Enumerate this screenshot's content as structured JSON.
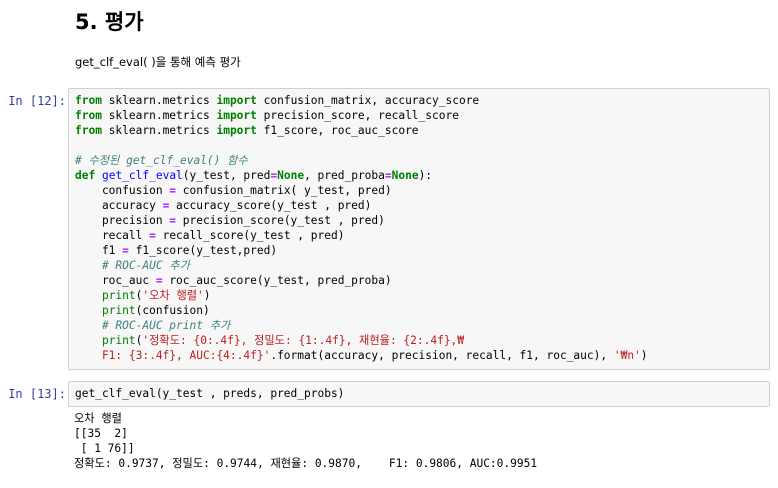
{
  "markdown": {
    "heading": "5. 평가",
    "text": "get_clf_eval( )을 통해 예측 평가"
  },
  "cell12": {
    "prompt": "In [12]:",
    "line1": {
      "a": "from",
      "b": " sklearn.metrics ",
      "c": "import",
      "d": " confusion_matrix, accuracy_score"
    },
    "line2": {
      "a": "from",
      "b": " sklearn.metrics ",
      "c": "import",
      "d": " precision_score, recall_score"
    },
    "line3": {
      "a": "from",
      "b": " sklearn.metrics ",
      "c": "import",
      "d": " f1_score, roc_auc_score"
    },
    "comment1": "# 수정된 get_clf_eval() 함수",
    "def": {
      "kw": "def",
      "name": "get_clf_eval",
      "args1": "(y_test, pred",
      "eq1": "=",
      "none1": "None",
      "args2": ", pred_proba",
      "eq2": "=",
      "none2": "None",
      "args3": "):"
    },
    "confusion": {
      "lhs": "    confusion ",
      "op": "=",
      "rhs": " confusion_matrix( y_test, pred)"
    },
    "accuracy": {
      "lhs": "    accuracy ",
      "op": "=",
      "rhs": " accuracy_score(y_test , pred)"
    },
    "precision": {
      "lhs": "    precision ",
      "op": "=",
      "rhs": " precision_score(y_test , pred)"
    },
    "recall": {
      "lhs": "    recall ",
      "op": "=",
      "rhs": " recall_score(y_test , pred)"
    },
    "f1": {
      "lhs": "    f1 ",
      "op": "=",
      "rhs": " f1_score(y_test,pred)"
    },
    "comment2": "    # ROC-AUC 추가",
    "rocauc": {
      "lhs": "    roc_auc ",
      "op": "=",
      "rhs": " roc_auc_score(y_test, pred_proba)"
    },
    "print1": {
      "fn": "print",
      "open": "(",
      "str": "'오차 행렬'",
      "close": ")"
    },
    "print2": {
      "fn": "print",
      "rest": "(confusion)"
    },
    "comment3": "    # ROC-AUC print 추가",
    "print3": {
      "fn": "print",
      "open": "(",
      "str": "'정확도: {0:.4f}, 정밀도: {1:.4f}, 재현율: {2:.4f},₩"
    },
    "print3b": {
      "str": "    F1: {3:.4f}, AUC:{4:.4f}'",
      "rest": ".format(accuracy, precision, recall, f1, roc_auc), ",
      "str2": "'₩n'",
      "close": ")"
    }
  },
  "cell13": {
    "prompt": "In [13]:",
    "code": "get_clf_eval(y_test , preds, pred_probs)"
  },
  "output13": {
    "line1": "오차 행렬",
    "line2": "[[35  2]",
    "line3": " [ 1 76]]",
    "line4": "정확도: 0.9737, 정밀도: 0.9744, 재현율: 0.9870,    F1: 0.9806, AUC:0.9951"
  },
  "colors": {
    "keyword": "#008000",
    "function_name": "#0000ff",
    "comment": "#408080",
    "string": "#ba2121",
    "operator": "#aa22ff",
    "prompt": "#303f9f",
    "cell_bg": "#f7f7f7"
  }
}
